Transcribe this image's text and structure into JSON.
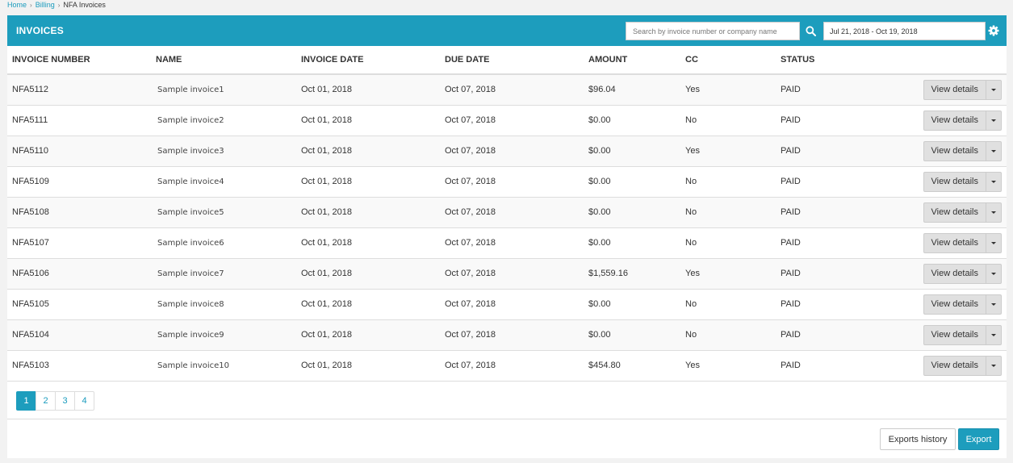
{
  "breadcrumb": {
    "items": [
      {
        "label": "Home"
      },
      {
        "label": "Billing"
      }
    ],
    "current": "NFA Invoices"
  },
  "header": {
    "title": "INVOICES",
    "search_placeholder": "Search by invoice number or company name",
    "date_range": "Jul 21, 2018 - Oct 19, 2018"
  },
  "table": {
    "columns": [
      "INVOICE NUMBER",
      "NAME",
      "INVOICE DATE",
      "DUE DATE",
      "AMOUNT",
      "CC",
      "STATUS"
    ],
    "view_details_label": "View details",
    "rows": [
      {
        "number": "NFA5112",
        "name": "Sample invoice1",
        "invoice_date": "Oct 01, 2018",
        "due_date": "Oct 07, 2018",
        "amount": "$96.04",
        "cc": "Yes",
        "status": "PAID"
      },
      {
        "number": "NFA5111",
        "name": "Sample invoice2",
        "invoice_date": "Oct 01, 2018",
        "due_date": "Oct 07, 2018",
        "amount": "$0.00",
        "cc": "No",
        "status": "PAID"
      },
      {
        "number": "NFA5110",
        "name": "Sample invoice3",
        "invoice_date": "Oct 01, 2018",
        "due_date": "Oct 07, 2018",
        "amount": "$0.00",
        "cc": "Yes",
        "status": "PAID"
      },
      {
        "number": "NFA5109",
        "name": "Sample invoice4",
        "invoice_date": "Oct 01, 2018",
        "due_date": "Oct 07, 2018",
        "amount": "$0.00",
        "cc": "No",
        "status": "PAID"
      },
      {
        "number": "NFA5108",
        "name": "Sample invoice5",
        "invoice_date": "Oct 01, 2018",
        "due_date": "Oct 07, 2018",
        "amount": "$0.00",
        "cc": "No",
        "status": "PAID"
      },
      {
        "number": "NFA5107",
        "name": "Sample invoice6",
        "invoice_date": "Oct 01, 2018",
        "due_date": "Oct 07, 2018",
        "amount": "$0.00",
        "cc": "No",
        "status": "PAID"
      },
      {
        "number": "NFA5106",
        "name": "Sample invoice7",
        "invoice_date": "Oct 01, 2018",
        "due_date": "Oct 07, 2018",
        "amount": "$1,559.16",
        "cc": "Yes",
        "status": "PAID"
      },
      {
        "number": "NFA5105",
        "name": "Sample invoice8",
        "invoice_date": "Oct 01, 2018",
        "due_date": "Oct 07, 2018",
        "amount": "$0.00",
        "cc": "No",
        "status": "PAID"
      },
      {
        "number": "NFA5104",
        "name": "Sample invoice9",
        "invoice_date": "Oct 01, 2018",
        "due_date": "Oct 07, 2018",
        "amount": "$0.00",
        "cc": "No",
        "status": "PAID"
      },
      {
        "number": "NFA5103",
        "name": "Sample invoice10",
        "invoice_date": "Oct 01, 2018",
        "due_date": "Oct 07, 2018",
        "amount": "$454.80",
        "cc": "Yes",
        "status": "PAID"
      }
    ]
  },
  "pagination": {
    "pages": [
      "1",
      "2",
      "3",
      "4"
    ],
    "active_index": 0
  },
  "footer": {
    "exports_history_label": "Exports history",
    "export_label": "Export"
  },
  "icons": {
    "search": "search-icon",
    "settings": "gear-icon",
    "dropdown": "caret-down-icon"
  },
  "colors": {
    "accent": "#1d9dbd",
    "link": "#1a9bbd"
  }
}
